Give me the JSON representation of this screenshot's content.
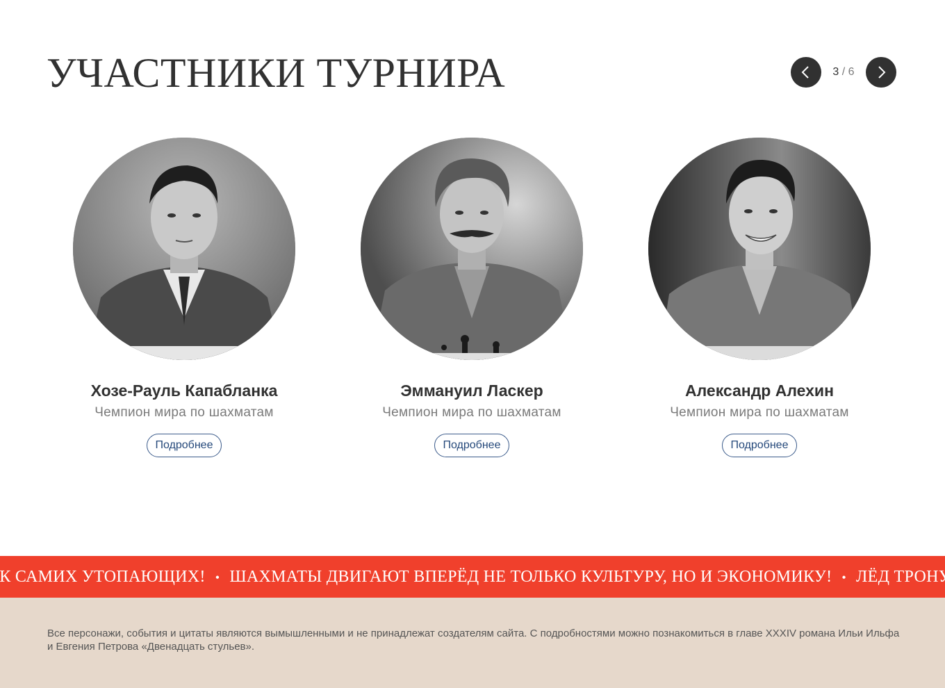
{
  "header": {
    "title": "УЧАСТНИКИ ТУРНИРА",
    "pager": {
      "current": "3",
      "separator": "/",
      "total": "6"
    }
  },
  "icons": {
    "prev": "chevron-left-icon",
    "next": "chevron-right-icon"
  },
  "cards": [
    {
      "name": "Хозе-Рауль Капабланка",
      "role": "Чемпион мира по шахматам",
      "button": "Подробнее"
    },
    {
      "name": "Эммануил Ласкер",
      "role": "Чемпион мира по шахматам",
      "button": "Подробнее"
    },
    {
      "name": "Александр Алехин",
      "role": "Чемпион мира по шахматам",
      "button": "Подробнее"
    }
  ],
  "ticker": {
    "items": [
      "УК САМИХ УТОПАЮЩИХ!",
      "ШАХМАТЫ ДВИГАЮТ ВПЕРЁД НЕ ТОЛЬКО КУЛЬТУРУ, НО И ЭКОНОМИКУ!",
      "ЛЁД ТРОНУЛСЯ"
    ],
    "separator": "•"
  },
  "footer": {
    "note": "Все персонажи, события и цитаты являются вымышленными и не принадлежат создателям сайта. С подробностями можно познакомиться в главе XXXIV романа Ильи Ильфа и Евгения Петрова «Двенадцать стульев»."
  },
  "colors": {
    "text": "#313131",
    "muted": "#7a7a7a",
    "accent_red": "#f0402c",
    "footer_bg": "#e6d8cb",
    "button_border": "#3a5a8a"
  }
}
